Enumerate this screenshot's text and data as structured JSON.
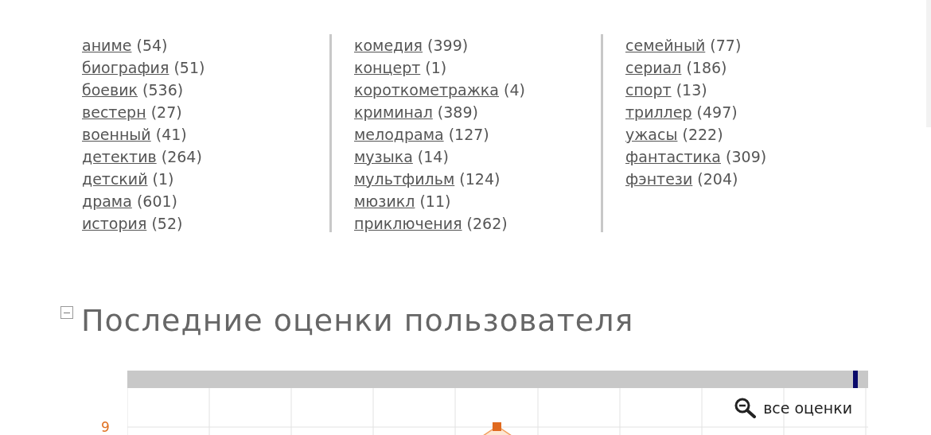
{
  "genres": [
    [
      {
        "name": "аниме",
        "count": "(54)"
      },
      {
        "name": "биография",
        "count": "(51)"
      },
      {
        "name": "боевик",
        "count": "(536)"
      },
      {
        "name": "вестерн",
        "count": "(27)"
      },
      {
        "name": "военный",
        "count": "(41)"
      },
      {
        "name": "детектив",
        "count": "(264)"
      },
      {
        "name": "детский",
        "count": "(1)"
      },
      {
        "name": "драма",
        "count": "(601)"
      },
      {
        "name": "история",
        "count": "(52)"
      }
    ],
    [
      {
        "name": "комедия",
        "count": "(399)"
      },
      {
        "name": "концерт",
        "count": "(1)"
      },
      {
        "name": "короткометражка",
        "count": "(4)"
      },
      {
        "name": "криминал",
        "count": "(389)"
      },
      {
        "name": "мелодрама",
        "count": "(127)"
      },
      {
        "name": "музыка",
        "count": "(14)"
      },
      {
        "name": "мультфильм",
        "count": "(124)"
      },
      {
        "name": "мюзикл",
        "count": "(11)"
      },
      {
        "name": "приключения",
        "count": "(262)"
      }
    ],
    [
      {
        "name": "семейный",
        "count": "(77)"
      },
      {
        "name": "сериал",
        "count": "(186)"
      },
      {
        "name": "спорт",
        "count": "(13)"
      },
      {
        "name": "триллер",
        "count": "(497)"
      },
      {
        "name": "ужасы",
        "count": "(222)"
      },
      {
        "name": "фантастика",
        "count": "(309)"
      },
      {
        "name": "фэнтези",
        "count": "(204)"
      }
    ]
  ],
  "section": {
    "title": "Последние оценки пользователя",
    "expanded": true
  },
  "chart": {
    "y_tick": "9",
    "zoom_link": "все оценки"
  }
}
